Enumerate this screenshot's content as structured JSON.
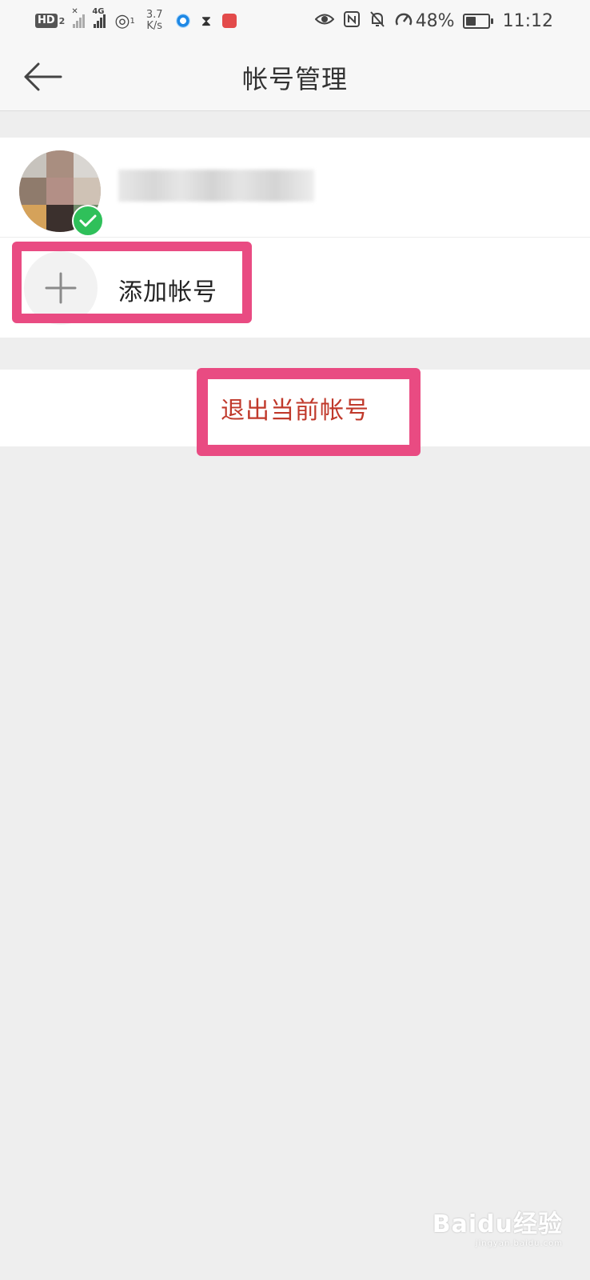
{
  "status_bar": {
    "hd_label": "HD",
    "hd_sub": "2",
    "signal2_label": "4G",
    "hotspot_count": "1",
    "speed_value": "3.7",
    "speed_unit": "K/s",
    "battery_text": "48%",
    "battery_level": 0.48,
    "time": "11:12"
  },
  "header": {
    "title": "帐号管理"
  },
  "accounts": {
    "add_label": "添加帐号"
  },
  "logout": {
    "label": "退出当前帐号"
  },
  "watermark": {
    "main": "Baidu经验",
    "sub": "jingyan.baidu.com"
  },
  "colors": {
    "accent_highlight": "#e94b82",
    "logout_text": "#c0392b",
    "check_green": "#2fc05a"
  }
}
